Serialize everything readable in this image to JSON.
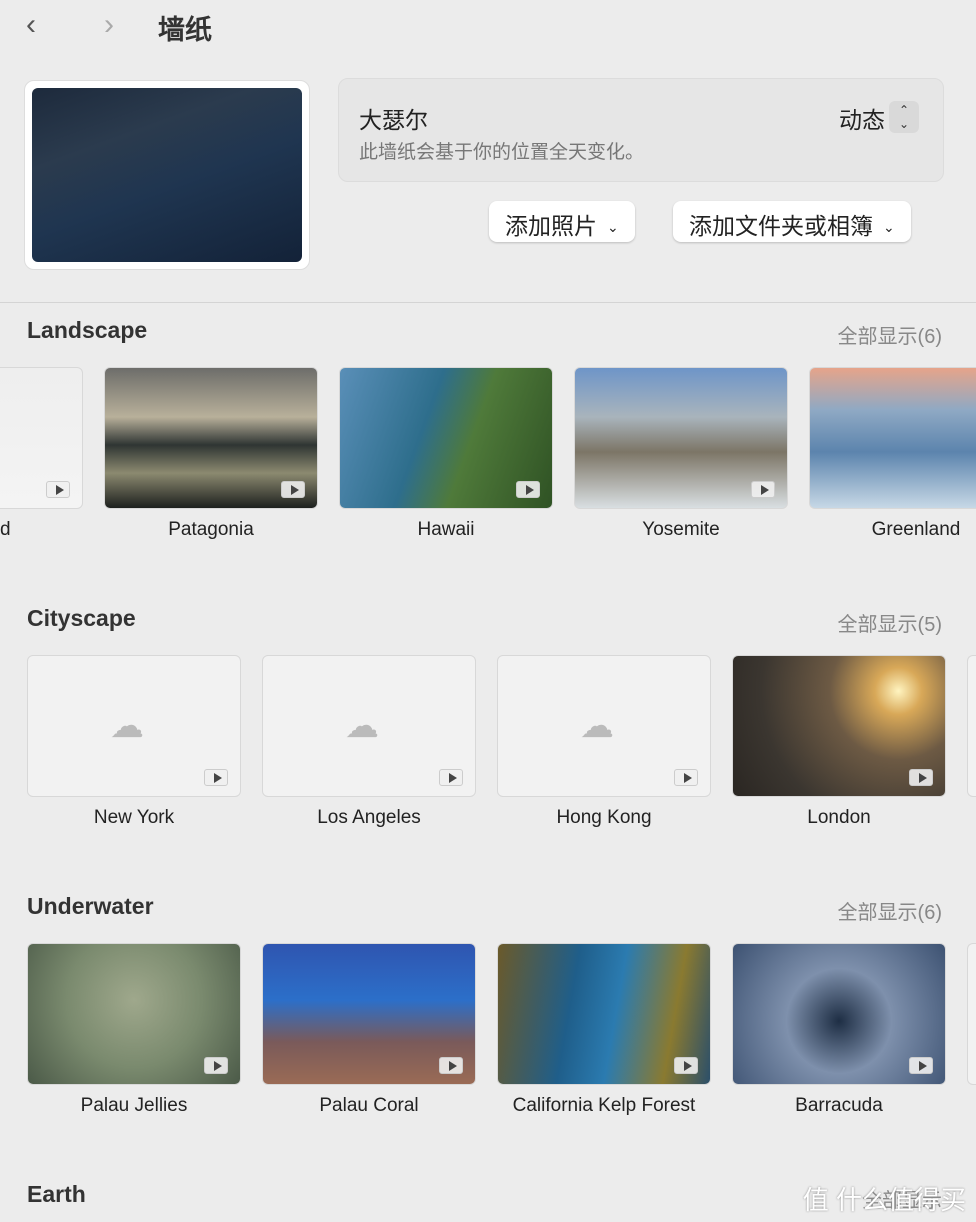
{
  "header": {
    "back": "‹",
    "forward": "›",
    "title": "墙纸"
  },
  "current": {
    "name": "大瑟尔",
    "description": "此墙纸会基于你的位置全天变化。",
    "mode": "动态"
  },
  "buttons": {
    "add_photo": "添加照片",
    "add_folder": "添加文件夹或相簿"
  },
  "sections": [
    {
      "title": "Landscape",
      "show_all": "全部显示(6)",
      "items": [
        {
          "label": "d",
          "bg": "linear-gradient(#eee,#f4f4f4)"
        },
        {
          "label": "Patagonia",
          "bg": "linear-gradient(180deg,#6d6d6a 0%,#b8b09a 35%,#2f3533 55%,#8c8a70 75%,#1d201e 100%)"
        },
        {
          "label": "Hawaii",
          "bg": "linear-gradient(110deg,#5a8fb8 0%,#2e6e8c 40%,#4f7a3a 60%,#2f5224 100%)"
        },
        {
          "label": "Yosemite",
          "bg": "linear-gradient(180deg,#6e95c8 0%,#a9b4bc 35%,#7c7566 60%,#d9dfe2 100%)"
        },
        {
          "label": "Greenland",
          "bg": "linear-gradient(180deg,#e6a48a 0%,#8fa9c4 30%,#5c84ad 60%,#c7d8e6 100%)"
        }
      ]
    },
    {
      "title": "Cityscape",
      "show_all": "全部显示(5)",
      "items": [
        {
          "label": "New York",
          "cloud": true
        },
        {
          "label": "Los Angeles",
          "cloud": true
        },
        {
          "label": "Hong Kong",
          "cloud": true
        },
        {
          "label": "London",
          "bg": "radial-gradient(circle at 78% 25%,#fff4c0 0%,#d8a858 12%,#6d5a44 35%,#3b3630 70%,#2a2622 100%)"
        }
      ]
    },
    {
      "title": "Underwater",
      "show_all": "全部显示(6)",
      "items": [
        {
          "label": "Palau Jellies",
          "bg": "radial-gradient(circle at 50% 40%,#9fa88c 0%,#7a8a6e 50%,#4b5a48 100%)"
        },
        {
          "label": "Palau Coral",
          "bg": "linear-gradient(180deg,#2f55b0 0%,#2c6fc9 40%,#7a5a5a 70%,#9a6b55 100%)"
        },
        {
          "label": "California Kelp Forest",
          "bg": "linear-gradient(100deg,#6b5a2a 0%,#1f5e8a 35%,#2b7bb0 55%,#8a7a30 80%,#2b4f6a 100%)"
        },
        {
          "label": "Barracuda",
          "bg": "radial-gradient(circle at 50% 55%,#1e2e44 0%,#7e90ac 40%,#3d5272 100%)"
        }
      ]
    },
    {
      "title": "Earth",
      "show_all": "全部显示"
    }
  ],
  "watermark": "值 什么值得买"
}
